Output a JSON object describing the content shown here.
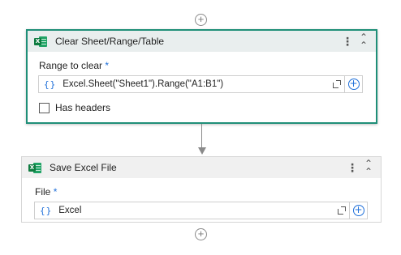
{
  "top_add": {
    "icon": "plus-circle-icon"
  },
  "activity1": {
    "title": "Clear Sheet/Range/Table",
    "icon": "excel-icon",
    "menu_icon": "kebab-menu-icon",
    "collapse_icon": "collapse-chevron-icon",
    "field_label": "Range to clear",
    "required_mark": "*",
    "braces": "{}",
    "field_value": "Excel.Sheet(\"Sheet1\").Range(\"A1:B1\")",
    "checkbox_label": "Has headers",
    "checkbox_checked": false
  },
  "activity2": {
    "title": "Save Excel File",
    "icon": "excel-icon",
    "menu_icon": "kebab-menu-icon",
    "collapse_icon": "collapse-chevron-icon",
    "field_label": "File",
    "required_mark": "*",
    "braces": "{}",
    "field_value": "Excel"
  },
  "bottom_add": {
    "icon": "plus-circle-icon"
  },
  "colors": {
    "selected_border": "#1f8f78",
    "accent_blue": "#1e6fd9",
    "excel_green": "#107c41"
  }
}
